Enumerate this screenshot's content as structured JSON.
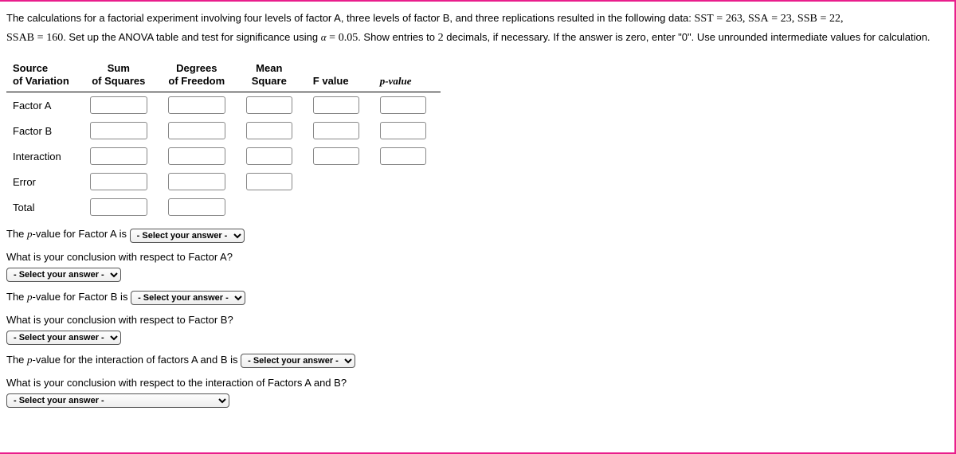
{
  "problem": {
    "line1_a": "The calculations for a factorial experiment involving four levels of factor A, three levels of factor B, and three replications resulted in the following data:",
    "sst_lhs": "SST",
    "eq": "=",
    "sst_val": "263",
    "ssa_lhs": "SSA",
    "ssa_val": "23",
    "ssb_lhs": "SSB",
    "ssb_val": "22",
    "comma": ",",
    "line2_a": "SSAB",
    "line2_val": "160",
    "line2_b": ". Set up the ANOVA table and test for significance using ",
    "alpha_sym": "α",
    "alpha_val": "0.05",
    "line2_c": ". Show entries to ",
    "two": "2",
    "line2_d": " decimals, if necessary. If the answer is zero, enter \"0\". Use unrounded intermediate values for calculation."
  },
  "table": {
    "headers": {
      "source1": "Source",
      "source2": "of Variation",
      "ss1": "Sum",
      "ss2": "of Squares",
      "df1": "Degrees",
      "df2": "of Freedom",
      "ms1": "Mean",
      "ms2": "Square",
      "f": "F value",
      "p": "p-value"
    },
    "rows": {
      "factorA": "Factor A",
      "factorB": "Factor B",
      "interaction": "Interaction",
      "error": "Error",
      "total": "Total"
    }
  },
  "questions": {
    "q1": "-value for Factor A is",
    "q1pre": "The ",
    "p": "p",
    "q2": "What is your conclusion with respect to Factor A?",
    "q3": "-value for Factor B is",
    "q4": "What is your conclusion with respect to Factor B?",
    "q5": "-value for the interaction of factors A and B is",
    "q6": "What is your conclusion with respect to the interaction of Factors A and B?"
  },
  "select_placeholder": "- Select your answer -"
}
